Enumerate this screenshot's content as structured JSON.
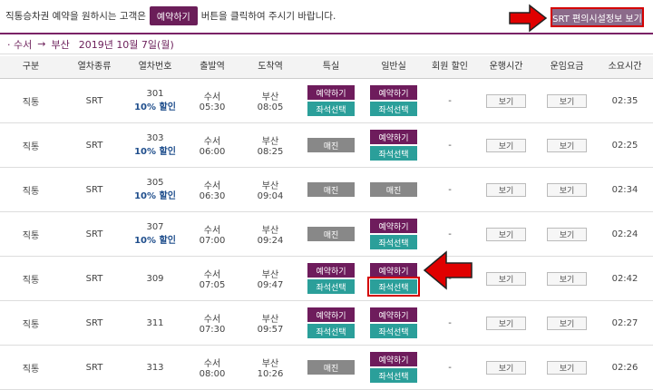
{
  "notice": {
    "before": "직통승차권 예약을 원하시는 고객은",
    "pill": "예약하기",
    "after": "버튼을 클릭하여 주시기 바랍니다."
  },
  "facility_button": "SRT 편의시설정보 보기",
  "route": {
    "from": "· 수서",
    "arrow": "→",
    "to": "부산",
    "date": "2019년 10월 7일(월)"
  },
  "headers": [
    "구분",
    "열차종류",
    "열차번호",
    "출발역",
    "도착역",
    "특실",
    "일반실",
    "회원 할인",
    "운행시간",
    "운임요금",
    "소요시간"
  ],
  "rows": [
    {
      "type": "직통",
      "kind": "SRT",
      "num": "301",
      "disc": "10% 할인",
      "dep_st": "수서",
      "dep": "05:30",
      "arr_st": "부산",
      "arr": "08:05",
      "special": "open",
      "normal": "open",
      "member": "-",
      "run": "보기",
      "fare": "보기",
      "dur": "02:35"
    },
    {
      "type": "직통",
      "kind": "SRT",
      "num": "303",
      "disc": "10% 할인",
      "dep_st": "수서",
      "dep": "06:00",
      "arr_st": "부산",
      "arr": "08:25",
      "special": "sold",
      "normal": "open",
      "member": "-",
      "run": "보기",
      "fare": "보기",
      "dur": "02:25"
    },
    {
      "type": "직통",
      "kind": "SRT",
      "num": "305",
      "disc": "10% 할인",
      "dep_st": "수서",
      "dep": "06:30",
      "arr_st": "부산",
      "arr": "09:04",
      "special": "sold",
      "normal": "sold",
      "member": "-",
      "run": "보기",
      "fare": "보기",
      "dur": "02:34"
    },
    {
      "type": "직통",
      "kind": "SRT",
      "num": "307",
      "disc": "10% 할인",
      "dep_st": "수서",
      "dep": "07:00",
      "arr_st": "부산",
      "arr": "09:24",
      "special": "sold",
      "normal": "open",
      "member": "-",
      "run": "보기",
      "fare": "보기",
      "dur": "02:24"
    },
    {
      "type": "직통",
      "kind": "SRT",
      "num": "309",
      "disc": "",
      "dep_st": "수서",
      "dep": "07:05",
      "arr_st": "부산",
      "arr": "09:47",
      "special": "open",
      "normal": "open",
      "member": "-",
      "run": "보기",
      "fare": "보기",
      "dur": "02:42"
    },
    {
      "type": "직통",
      "kind": "SRT",
      "num": "311",
      "disc": "",
      "dep_st": "수서",
      "dep": "07:30",
      "arr_st": "부산",
      "arr": "09:57",
      "special": "open",
      "normal": "open",
      "member": "-",
      "run": "보기",
      "fare": "보기",
      "dur": "02:27"
    },
    {
      "type": "직통",
      "kind": "SRT",
      "num": "313",
      "disc": "",
      "dep_st": "수서",
      "dep": "08:00",
      "arr_st": "부산",
      "arr": "10:26",
      "special": "sold",
      "normal": "open",
      "member": "-",
      "run": "보기",
      "fare": "보기",
      "dur": "02:26"
    }
  ],
  "labels": {
    "reserve": "예약하기",
    "seat": "좌석선택",
    "sold": "매진"
  },
  "colors": {
    "brand": "#6e1c5c",
    "seat": "#2b9f9a",
    "sold": "#888888",
    "highlight": "#d40000"
  },
  "icons": {
    "arrow1": "red-arrow-right-icon",
    "arrow2": "red-arrow-left-icon"
  }
}
